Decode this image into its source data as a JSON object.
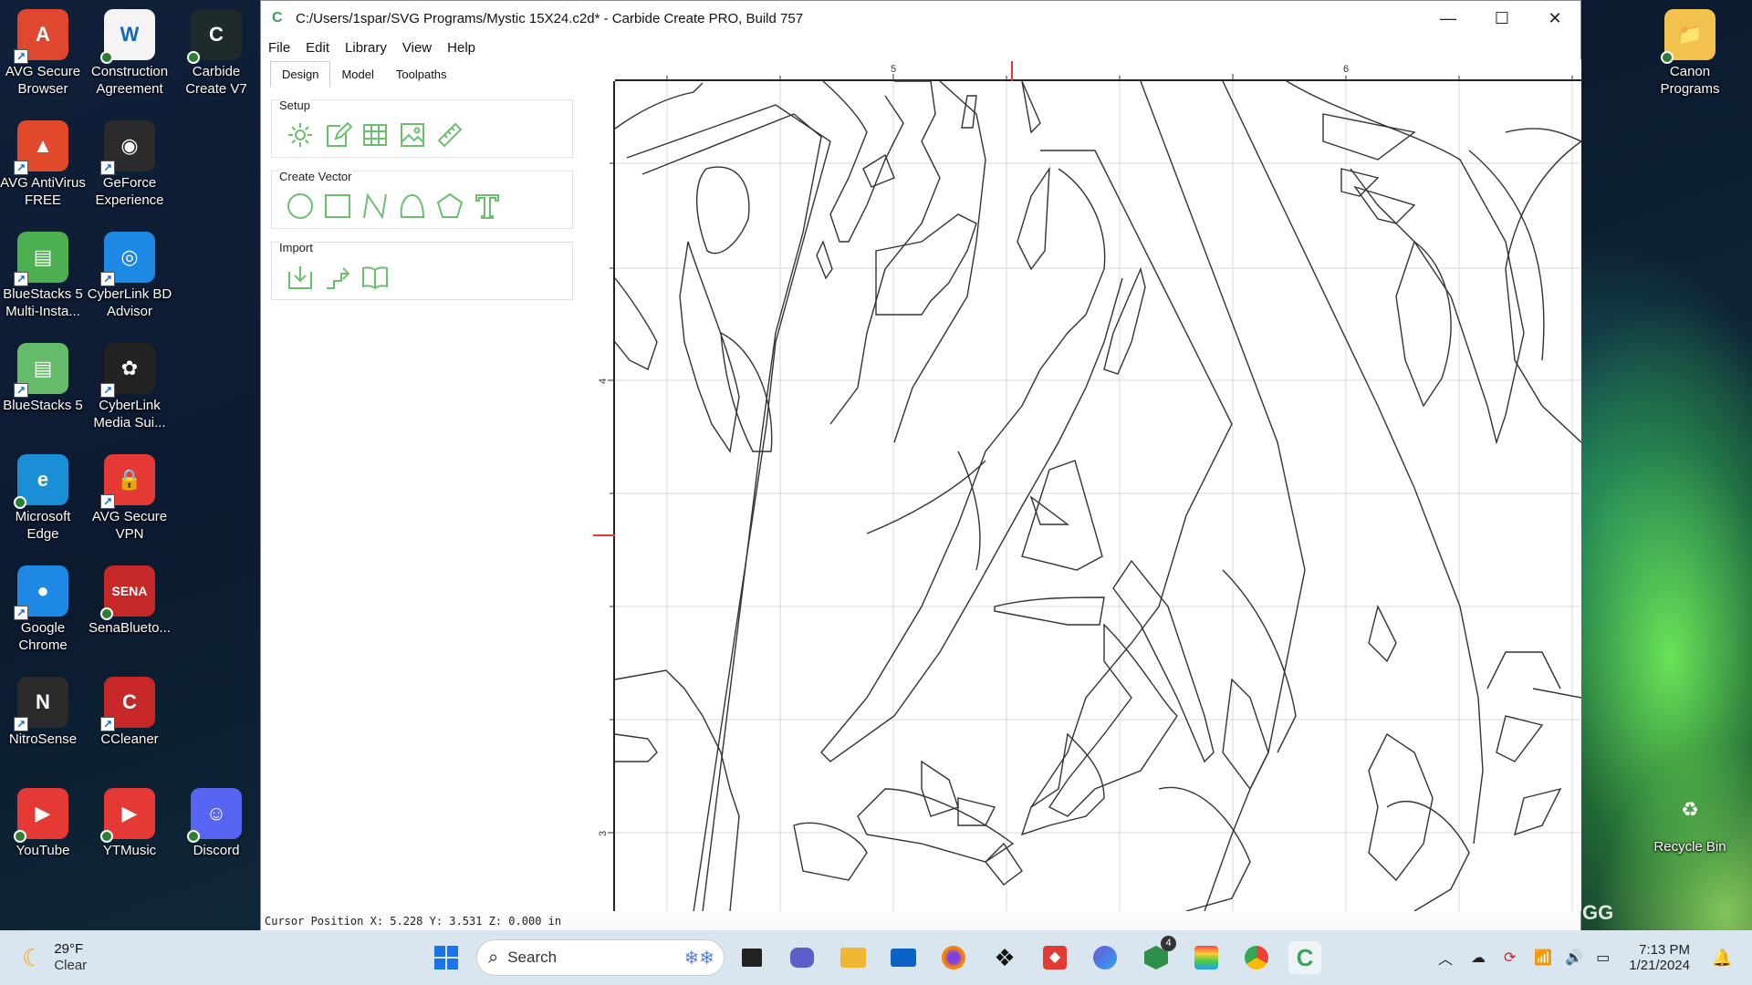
{
  "desktop": {
    "icons": [
      {
        "label": "AVG Secure Browser",
        "lines": [
          "AVG Secure",
          "Browser"
        ],
        "color": "#e0472f",
        "glyph": "A",
        "badge": "shortcut"
      },
      {
        "label": "Construction Agreement",
        "lines": [
          "Construction",
          "Agreement"
        ],
        "color": "#f4f4f4",
        "glyph": "W",
        "badge": "sync"
      },
      {
        "label": "Carbide Create V7",
        "lines": [
          "Carbide",
          "Create V7"
        ],
        "color": "#1f2a2a",
        "glyph": "C",
        "badge": "sync"
      },
      {
        "label": "AVG AntiVirus FREE",
        "lines": [
          "AVG AntiVirus",
          "FREE"
        ],
        "color": "#e04a2a",
        "glyph": "▲",
        "badge": "shortcut"
      },
      {
        "label": "GeForce Experience",
        "lines": [
          "GeForce",
          "Experience"
        ],
        "color": "#2b2b2b",
        "glyph": "◉",
        "badge": "shortcut"
      },
      {
        "label": "BlueStacks 5 Multi-Instance",
        "lines": [
          "BlueStacks 5",
          "Multi-Insta..."
        ],
        "color": "#4caf50",
        "glyph": "▤",
        "badge": "shortcut"
      },
      {
        "label": "CyberLink BD Advisor",
        "lines": [
          "CyberLink BD",
          "Advisor"
        ],
        "color": "#1e88e5",
        "glyph": "◎",
        "badge": "shortcut"
      },
      {
        "label": "BlueStacks 5",
        "lines": [
          "BlueStacks 5"
        ],
        "color": "#66bb6a",
        "glyph": "▤",
        "badge": "shortcut"
      },
      {
        "label": "CyberLink Media Suite",
        "lines": [
          "CyberLink",
          "Media Sui..."
        ],
        "color": "#222",
        "glyph": "✿",
        "badge": "shortcut"
      },
      {
        "label": "Microsoft Edge",
        "lines": [
          "Microsoft",
          "Edge"
        ],
        "color": "#1a8fd6",
        "glyph": "e",
        "badge": "sync"
      },
      {
        "label": "AVG Secure VPN",
        "lines": [
          "AVG Secure",
          "VPN"
        ],
        "color": "#e53935",
        "glyph": "🔒",
        "badge": "shortcut"
      },
      {
        "label": "Google Chrome",
        "lines": [
          "Google",
          "Chrome"
        ],
        "color": "#1e88e5",
        "glyph": "●",
        "badge": "shortcut"
      },
      {
        "label": "SenaBluetooth",
        "lines": [
          "SenaBlueto..."
        ],
        "color": "#c62828",
        "glyph": "SENA",
        "badge": "sync"
      },
      {
        "label": "NitroSense",
        "lines": [
          "NitroSense"
        ],
        "color": "#2a2a2a",
        "glyph": "N",
        "badge": "shortcut"
      },
      {
        "label": "CCleaner",
        "lines": [
          "CCleaner"
        ],
        "color": "#c62828",
        "glyph": "C",
        "badge": "shortcut"
      },
      {
        "label": "YouTube",
        "lines": [
          "YouTube"
        ],
        "color": "#e53935",
        "glyph": "▶",
        "badge": "sync"
      },
      {
        "label": "YTMusic",
        "lines": [
          "YTMusic"
        ],
        "color": "#e53935",
        "glyph": "▶",
        "badge": "sync"
      },
      {
        "label": "Discord",
        "lines": [
          "Discord"
        ],
        "color": "#5865f2",
        "glyph": "☺",
        "badge": "sync"
      },
      {
        "label": "Canon Programs",
        "lines": [
          "Canon",
          "Programs"
        ],
        "color": "#f2c14e",
        "glyph": "📁",
        "badge": "sync"
      },
      {
        "label": "Recycle Bin",
        "lines": [
          "Recycle Bin"
        ],
        "color": "transparent",
        "glyph": "♻",
        "badge": "none"
      }
    ],
    "watermark": "GG"
  },
  "window": {
    "title": "C:/Users/1spar/SVG Programs/Mystic 15X24.c2d* - Carbide Create PRO, Build 757",
    "minimize_glyph": "—",
    "maximize_glyph": "☐",
    "close_glyph": "✕",
    "menu": [
      "File",
      "Edit",
      "Library",
      "View",
      "Help"
    ],
    "tabs": [
      "Design",
      "Model",
      "Toolpaths"
    ],
    "active_tab": "Design",
    "groups": {
      "setup": {
        "title": "Setup",
        "tools": [
          "job-setup-gear",
          "edit-note",
          "grid",
          "image",
          "ruler"
        ]
      },
      "create_vector": {
        "title": "Create Vector",
        "tools": [
          "circle",
          "rectangle",
          "polyline",
          "curve",
          "polygon",
          "text"
        ]
      },
      "import": {
        "title": "Import",
        "tools": [
          "import-vectors",
          "import-toolpath",
          "library-book"
        ]
      }
    },
    "ruler": {
      "top_labels": [
        "5",
        "6"
      ],
      "left_labels": [
        "4",
        "3"
      ]
    },
    "status": "Cursor Position X: 5.228 Y: 3.531 Z: 0.000 in"
  },
  "taskbar": {
    "weather": {
      "temp": "29°F",
      "condition": "Clear"
    },
    "search_placeholder": "Search",
    "apps": [
      "start",
      "search",
      "task-view",
      "teams-meet",
      "file-explorer",
      "mail",
      "firefox",
      "dropbox",
      "anydesk",
      "copilot",
      "carbide-create-v7",
      "bluestacks",
      "chrome",
      "carbide-create"
    ],
    "carbide_badge": "4",
    "clock": {
      "time": "7:13 PM",
      "date": "1/21/2024"
    }
  }
}
